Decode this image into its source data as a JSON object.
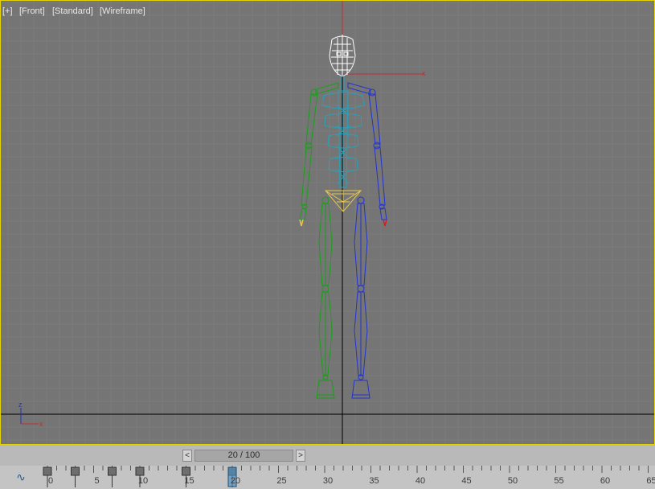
{
  "viewport": {
    "labels": [
      "[+]",
      "[Front]",
      "[Standard]",
      "[Wireframe]"
    ],
    "axis": {
      "x": "x",
      "z": "z"
    },
    "gizmo_x_label": "x"
  },
  "colors": {
    "viewport_bg": "#757575",
    "viewport_border": "#e6d200",
    "grid_line": "#7c7c7c",
    "axis_line": "#000000",
    "spine": "#2aa0b8",
    "left_limbs": "#19a019",
    "right_limbs": "#2233cc",
    "head": "#ffffff",
    "pelvis": "#e8c84a",
    "gizmo": "#c03030"
  },
  "icons": {
    "prev_frame": "chevron-left-icon",
    "next_frame": "chevron-right-icon",
    "curve_editor": "function-curve-icon"
  },
  "time_slider": {
    "prev_label": "<",
    "next_label": ">",
    "frame_text": "20 / 100",
    "current_frame": 20,
    "total_frames": 100
  },
  "track_bar": {
    "curve_icon_glyph": "∿",
    "tick_labels": [
      "0",
      "5",
      "10",
      "15",
      "20",
      "25",
      "30",
      "35",
      "40",
      "45",
      "50",
      "55",
      "60",
      "65"
    ],
    "keyframes": [
      0,
      3,
      7,
      10,
      15,
      20
    ],
    "current_frame": 20
  }
}
